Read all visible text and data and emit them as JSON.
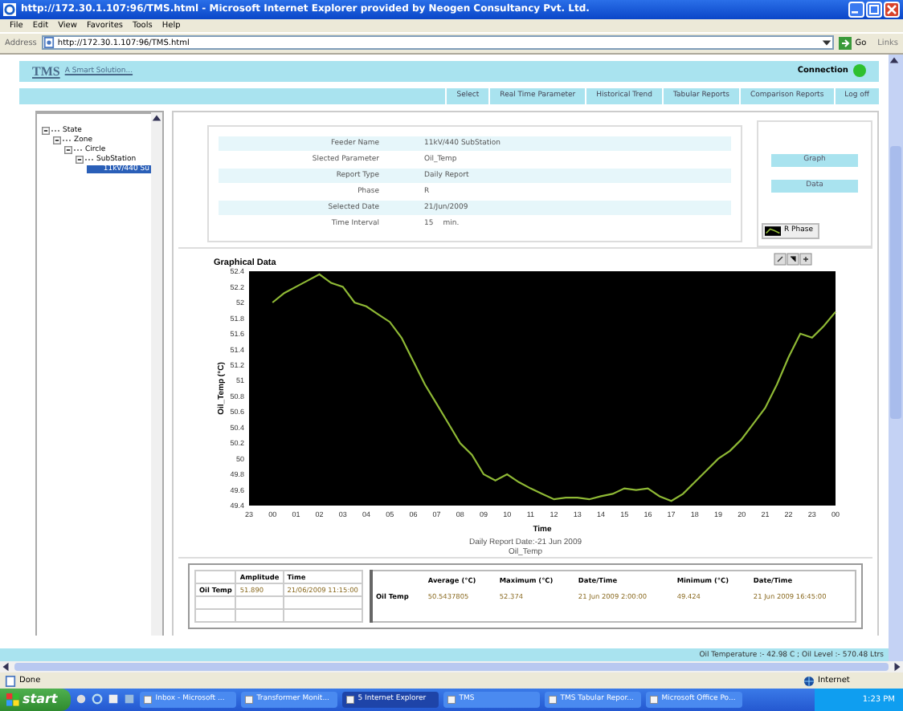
{
  "window": {
    "title": "http://172.30.1.107:96/TMS.html - Microsoft Internet Explorer provided by Neogen Consultancy Pvt. Ltd."
  },
  "menu": [
    "File",
    "Edit",
    "View",
    "Favorites",
    "Tools",
    "Help"
  ],
  "address_bar": {
    "label": "Address",
    "value": "http://172.30.1.107:96/TMS.html",
    "go": "Go",
    "links": "Links"
  },
  "header": {
    "logo": "TMS",
    "tagline": "A Smart Solution...",
    "connection_label": "Connection",
    "connected": true
  },
  "nav": [
    "Select",
    "Real Time Parameter",
    "Historical Trend",
    "Tabular Reports",
    "Comparison Reports",
    "Log off"
  ],
  "tree": [
    {
      "label": "State",
      "expanded": true,
      "selected": false,
      "children": [
        {
          "label": "Zone",
          "expanded": true,
          "selected": false,
          "children": [
            {
              "label": "Circle",
              "expanded": true,
              "selected": false,
              "children": [
                {
                  "label": "SubStation",
                  "expanded": true,
                  "selected": false,
                  "children": [
                    {
                      "label": "11kV/440 Su",
                      "selected": true
                    }
                  ]
                }
              ]
            }
          ]
        }
      ]
    }
  ],
  "info": [
    {
      "label": "Feeder Name",
      "value": "11kV/440 SubStation"
    },
    {
      "label": "Slected Parameter",
      "value": "Oil_Temp"
    },
    {
      "label": "Report Type",
      "value": "Daily Report"
    },
    {
      "label": "Phase",
      "value": "R"
    },
    {
      "label": "Selected Date",
      "value": "21/Jun/2009"
    },
    {
      "label": "Time Interval",
      "value": "15",
      "unit": "min."
    }
  ],
  "view_buttons": [
    "Graph",
    "Data"
  ],
  "chart": {
    "caption_lines": [
      "Daily Report Date:-21 Jun 2009",
      "Oil_Temp"
    ],
    "chart_data": {
      "type": "line",
      "title": "Graphical Data",
      "xlabel": "Time",
      "ylabel": "Oil_Temp (°C)",
      "categories": [
        "23",
        null,
        "00",
        null,
        "01",
        null,
        "02",
        null,
        "03",
        null,
        "04",
        null,
        "05",
        null,
        "06",
        null,
        "07",
        null,
        "08",
        null,
        "09",
        null,
        "10",
        null,
        "11",
        null,
        "12",
        null,
        "13",
        null,
        "14",
        null,
        "15",
        null,
        "16",
        null,
        "17",
        null,
        "18",
        null,
        "19",
        null,
        "20",
        null,
        "21",
        null,
        "22",
        null,
        "23",
        null,
        "00"
      ],
      "series": [
        {
          "name": "R Phase",
          "color": "#8fb935",
          "values": [
            null,
            null,
            52.0,
            52.12,
            52.2,
            52.28,
            52.36,
            52.25,
            52.2,
            52.0,
            51.95,
            51.85,
            51.75,
            51.55,
            51.25,
            50.95,
            50.7,
            50.45,
            50.2,
            50.05,
            49.8,
            49.72,
            49.8,
            49.7,
            49.62,
            49.55,
            49.48,
            49.5,
            49.5,
            49.48,
            49.52,
            49.55,
            49.62,
            49.6,
            49.62,
            49.52,
            49.46,
            49.55,
            49.7,
            49.85,
            50.0,
            50.1,
            50.25,
            50.45,
            50.65,
            50.95,
            51.3,
            51.6,
            51.55,
            51.7,
            51.88
          ]
        }
      ],
      "ylim": [
        49.4,
        52.4
      ],
      "yticks": [
        {
          "value": 49.4,
          "label": "49.4"
        },
        {
          "value": 49.6,
          "label": "49.6"
        },
        {
          "value": 49.8,
          "label": "49.8"
        },
        {
          "value": 50,
          "label": "50"
        },
        {
          "value": 50.2,
          "label": "50.2"
        },
        {
          "value": 50.4,
          "label": "50.4"
        },
        {
          "value": 50.6,
          "label": "50.6"
        },
        {
          "value": 50.8,
          "label": "50.8"
        },
        {
          "value": 51,
          "label": "51"
        },
        {
          "value": 51.2,
          "label": "51.2"
        },
        {
          "value": 51.4,
          "label": "51.4"
        },
        {
          "value": 51.6,
          "label": "51.6"
        },
        {
          "value": 51.8,
          "label": "51.8"
        },
        {
          "value": 52,
          "label": "52"
        },
        {
          "value": 52.2,
          "label": "52.2"
        },
        {
          "value": 52.4,
          "label": "52.4"
        }
      ]
    }
  },
  "amplitude_table": {
    "columns": [
      "Amplitude",
      "Time"
    ],
    "rows": [
      {
        "name": "Oil Temp",
        "cells": [
          "51.890",
          "21/06/2009 11:15:00"
        ]
      }
    ]
  },
  "summary_table": {
    "row_name": "Oil Temp",
    "columns": [
      "Average (°C)",
      "Maximum (°C)",
      "Date/Time",
      "Minimum (°C)",
      "Date/Time"
    ],
    "cells": [
      "50.5437805",
      "52.374",
      "21 Jun 2009 2:00:00",
      "49.424",
      "21 Jun 2009 16:45:00"
    ]
  },
  "status_strip": "Oil Temperature :- 42.98 C ; Oil Level :- 570.48 Ltrs",
  "ie_status": {
    "left": "Done",
    "right": "Internet"
  },
  "taskbar": {
    "start": "start",
    "tasks": [
      {
        "label": "Inbox - Microsoft ...",
        "selected": false
      },
      {
        "label": "Transformer Monit...",
        "selected": false
      },
      {
        "label": "5 Internet Explorer",
        "selected": true
      },
      {
        "label": "TMS",
        "selected": false
      },
      {
        "label": "TMS Tabular Repor...",
        "selected": false
      },
      {
        "label": "Microsoft Office Po...",
        "selected": false
      }
    ],
    "clock": "1:23 PM"
  }
}
